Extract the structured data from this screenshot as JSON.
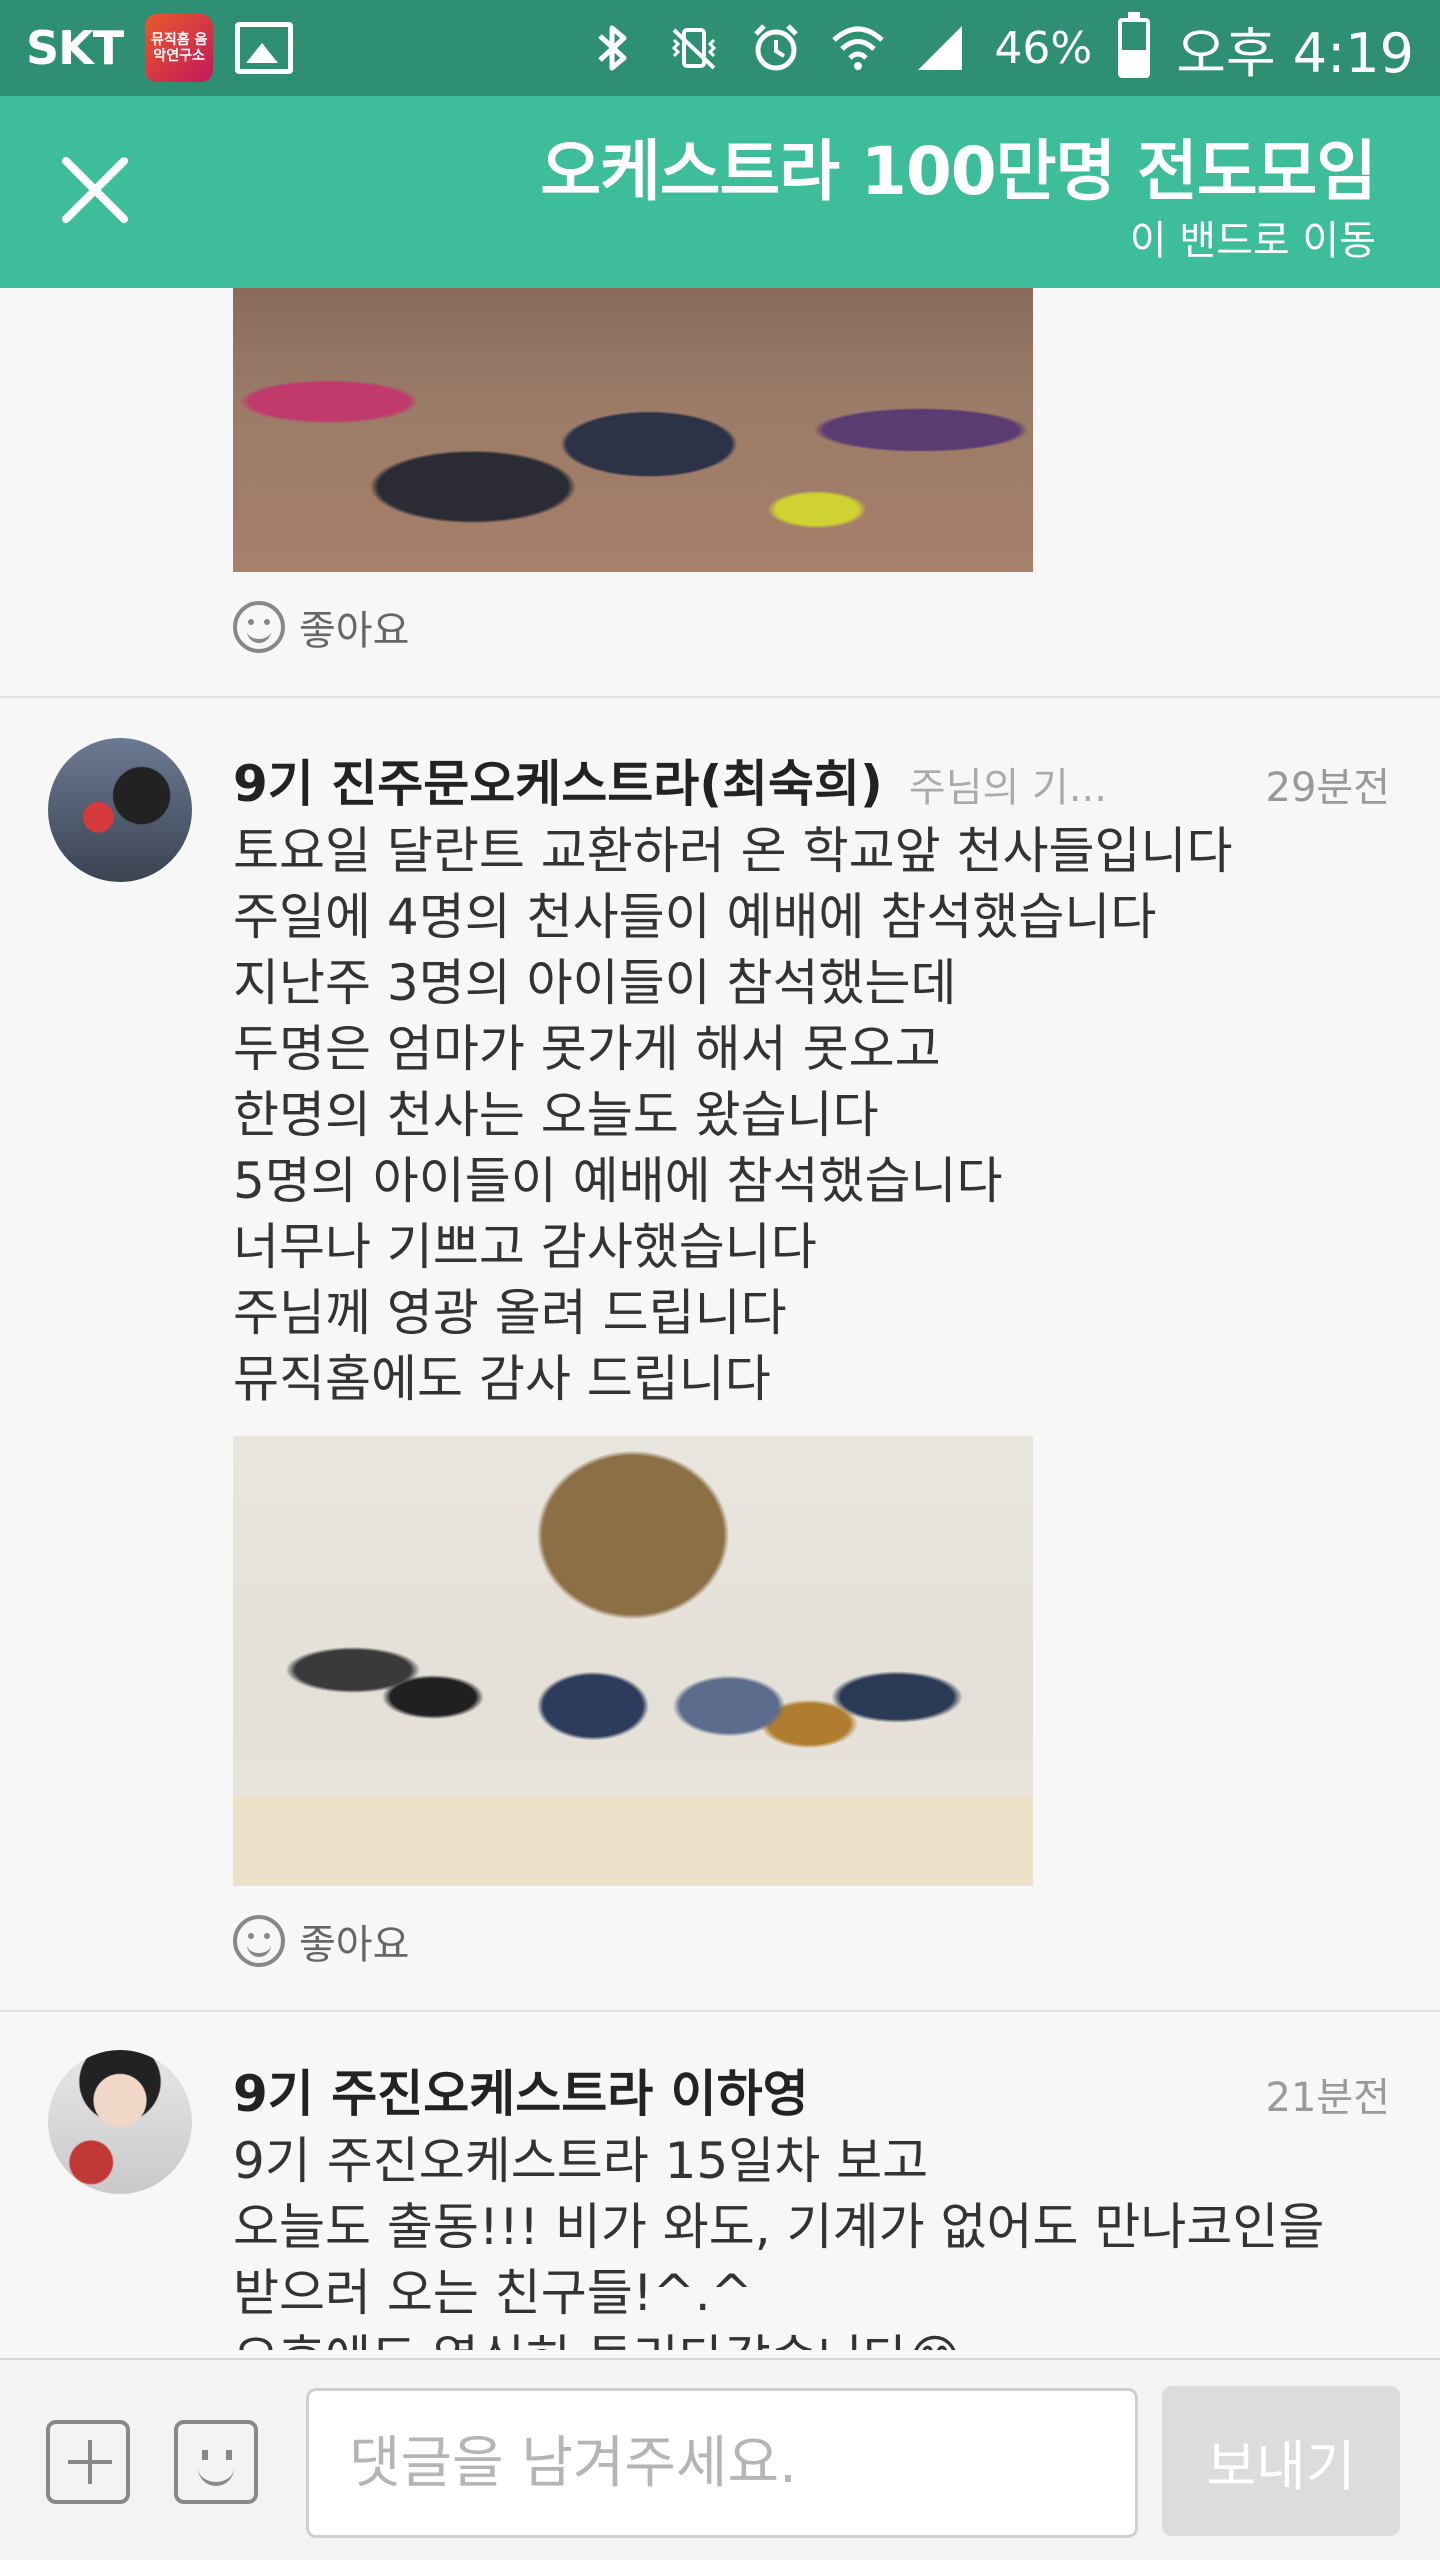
{
  "status_bar": {
    "carrier": "SKT",
    "app_badge": "뮤직홈 음악연구소",
    "battery": "46%",
    "battery_level": 0.46,
    "time": "오후 4:19"
  },
  "header": {
    "title": "오케스트라 100만명 전도모임",
    "subtitle": "이 밴드로 이동"
  },
  "feed": {
    "like_label": "좋아요",
    "posts": [
      {
        "author": "9기 진주문오케스트라(최숙희)",
        "band": "주님의 기...",
        "time": "29분전",
        "lines": [
          "토요일 달란트 교환하러 온 학교앞 천사들입니다",
          "주일에 4명의 천사들이 예배에 참석했습니다",
          "지난주 3명의 아이들이 참석했는데",
          "두명은 엄마가 못가게 해서 못오고",
          "한명의 천사는 오늘도 왔습니다",
          "5명의 아이들이 예배에 참석했습니다",
          "너무나 기쁘고 감사했습니다",
          "주님께 영광 올려 드립니다",
          "뮤직홈에도 감사 드립니다"
        ]
      },
      {
        "author": "9기 주진오케스트라 이하영",
        "time": "21분전",
        "lines": [
          "9기 주진오케스트라 15일차 보고",
          "오늘도 출동!!! 비가 와도, 기계가 없어도 만나코인을",
          "받으러 오는 친구들!^.^",
          "오후에도 열심히 돌리다갑습니다😊"
        ]
      }
    ]
  },
  "comment_bar": {
    "placeholder": "댓글을 남겨주세요.",
    "send_label": "보내기"
  }
}
